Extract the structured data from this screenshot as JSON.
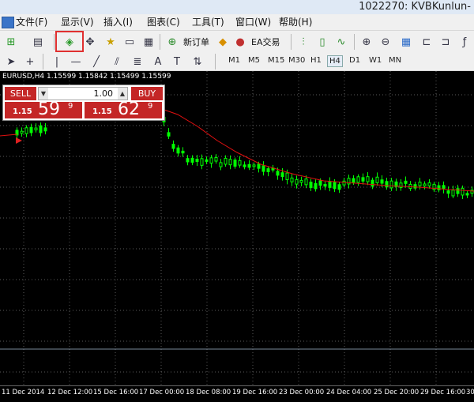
{
  "window": {
    "title": "1022270: KVBKunlun-"
  },
  "menu": [
    "文件(F)",
    "显示(V)",
    "插入(I)",
    "图表(C)",
    "工具(T)",
    "窗口(W)",
    "帮助(H)"
  ],
  "toolbar": {
    "new_order_label": "新订单",
    "ea_label": "EA交易"
  },
  "timeframes": [
    "M1",
    "M5",
    "M15",
    "M30",
    "H1",
    "H4",
    "D1",
    "W1",
    "MN"
  ],
  "active_timeframe": "H4",
  "chart": {
    "symbol_info": "EURUSD,H4  1.15599 1.15842 1.15499 1.15599",
    "sell_label": "SELL",
    "buy_label": "BUY",
    "lot": "1.00",
    "sell_price": {
      "prefix": "1.15",
      "big": "59",
      "sup": "9"
    },
    "buy_price": {
      "prefix": "1.15",
      "big": "62",
      "sup": "9"
    },
    "bull_color": "#00ff00",
    "ma_color": "#e01010"
  },
  "x_axis": [
    "11 Dec 2014",
    "12 Dec 12:00",
    "15 Dec 16:00",
    "17 Dec 00:00",
    "18 Dec 08:00",
    "19 Dec 16:00",
    "23 Dec 00:00",
    "24 Dec 04:00",
    "25 Dec 20:00",
    "29 Dec 16:00",
    "30"
  ]
}
